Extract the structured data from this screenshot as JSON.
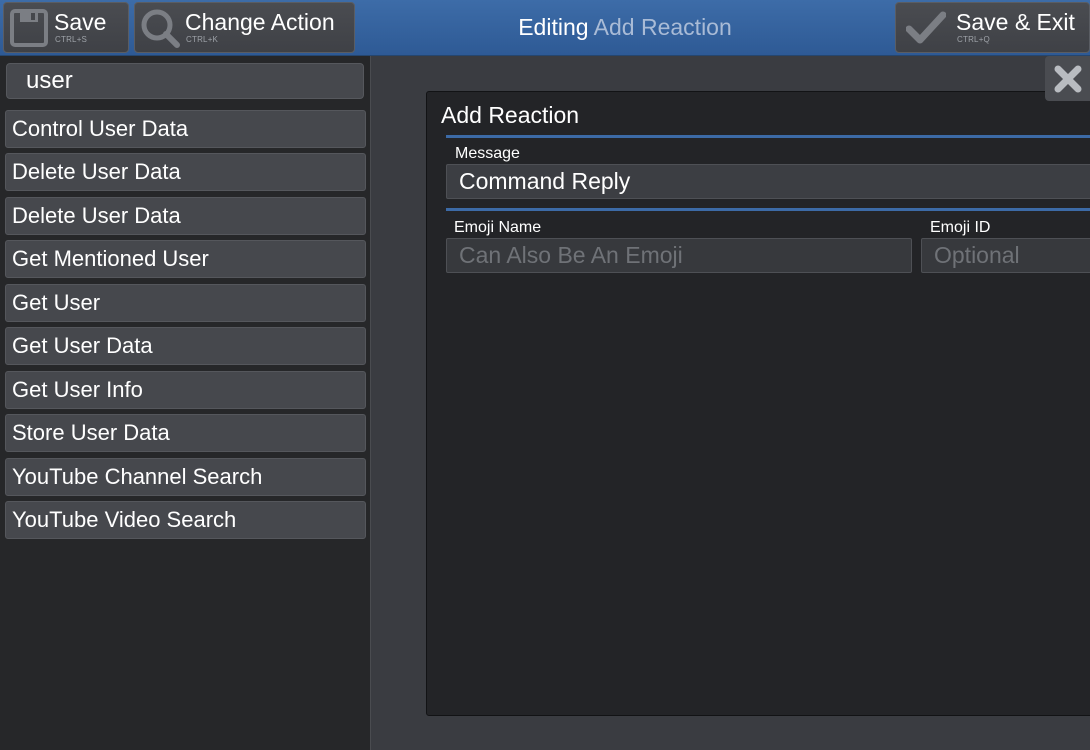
{
  "toolbar": {
    "save": {
      "label": "Save",
      "shortcut": "CTRL+S",
      "icon": "floppy-disk-icon"
    },
    "change_action": {
      "label": "Change Action",
      "shortcut": "CTRL+K",
      "icon": "magnifier-icon"
    },
    "save_exit": {
      "label": "Save & Exit",
      "shortcut": "CTRL+Q",
      "icon": "checkmark-icon"
    },
    "title_prefix": "Editing",
    "title_action": "Add Reaction"
  },
  "sidebar": {
    "search_value": "user",
    "items": [
      "Control User Data",
      "Delete User Data",
      "Delete User Data",
      "Get Mentioned User",
      "Get User",
      "Get User Data",
      "Get User Info",
      "Store User Data",
      "YouTube Channel Search",
      "YouTube Video Search"
    ]
  },
  "editor": {
    "close_icon": "close-x-icon",
    "title": "Add Reaction",
    "message": {
      "label": "Message",
      "value": "Command Reply"
    },
    "emoji_name": {
      "label": "Emoji Name",
      "placeholder": "Can Also Be An Emoji"
    },
    "emoji_id": {
      "label": "Emoji ID",
      "placeholder": "Optional"
    }
  },
  "colors": {
    "topbar": "#3d6ca8",
    "accent_divider": "#3c6aa6",
    "title_action": "#a9bbd6",
    "panel": "#232427",
    "sidebar": "#262729"
  }
}
